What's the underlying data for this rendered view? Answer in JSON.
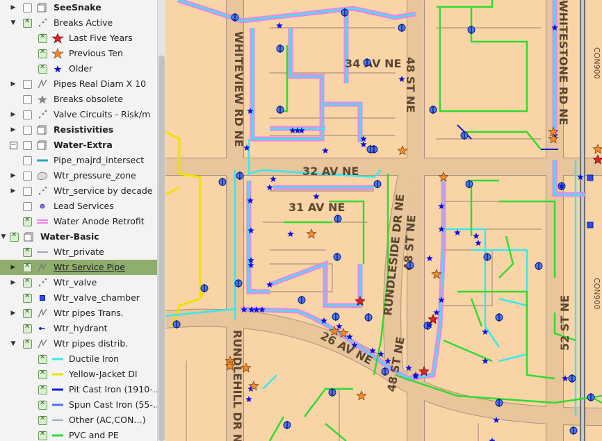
{
  "layers": [
    {
      "label": "SeeSnake",
      "level": 0,
      "expand": "right",
      "check": "off",
      "symbol": "group-icon",
      "bold": true
    },
    {
      "label": "Breaks Active",
      "level": 0,
      "expand": "down",
      "check": "on",
      "symbol": "points-icon"
    },
    {
      "label": "Last Five Years",
      "level": 1,
      "check": "on",
      "symbol": "star-red"
    },
    {
      "label": "Previous Ten",
      "level": 1,
      "check": "on",
      "symbol": "star-orange"
    },
    {
      "label": "Older",
      "level": 1,
      "check": "on",
      "symbol": "star-blue"
    },
    {
      "label": "Pipes Real Diam X 10",
      "level": 0,
      "expand": "right",
      "check": "off",
      "symbol": "line-icon"
    },
    {
      "label": "Breaks obsolete",
      "level": 0,
      "check": "off",
      "symbol": "star-gray"
    },
    {
      "label": "Valve Circuits - Risk/m",
      "level": 0,
      "expand": "right",
      "check": "off",
      "symbol": "points-icon"
    },
    {
      "label": "Resistivities",
      "level": 0,
      "expand": "right",
      "check": "off",
      "symbol": "group-icon",
      "bold": true
    },
    {
      "label": "Water-Extra",
      "level": 0,
      "expand": "minus",
      "check": "off",
      "symbol": "group-icon",
      "bold": true
    },
    {
      "label": "Pipe_majrd_intersect",
      "level": 0,
      "check": "off",
      "symbol": "line-teal"
    },
    {
      "label": "Wtr_pressure_zone",
      "level": 0,
      "expand": "right",
      "check": "off",
      "symbol": "polygon-icon"
    },
    {
      "label": "Wtr_service by decade",
      "level": 0,
      "expand": "right",
      "check": "off",
      "symbol": "points-icon"
    },
    {
      "label": "Lead Services",
      "level": 0,
      "check": "off",
      "symbol": "dot-purple"
    },
    {
      "label": "Water Anode Retrofit",
      "level": 0,
      "check": "on",
      "symbol": "line-pink"
    },
    {
      "label": "Water-Basic",
      "level": 0,
      "expand": "down",
      "check": "on",
      "symbol": "group-icon",
      "bold": true,
      "outdent": true
    },
    {
      "label": "Wtr_private",
      "level": 0,
      "check": "on",
      "symbol": "line-gray"
    },
    {
      "label": "Wtr Service Pipe",
      "level": 0,
      "expand": "right",
      "check": "on",
      "symbol": "line-icon",
      "selected": true
    },
    {
      "label": "Wtr_valve",
      "level": 0,
      "expand": "right",
      "check": "on",
      "symbol": "points-icon"
    },
    {
      "label": "Wtr_valve_chamber",
      "level": 0,
      "check": "on",
      "symbol": "square-blue"
    },
    {
      "label": "Wtr pipes Trans.",
      "level": 0,
      "expand": "right",
      "check": "on",
      "symbol": "line-icon"
    },
    {
      "label": "Wtr_hydrant",
      "level": 0,
      "check": "on",
      "symbol": "hydrant-icon"
    },
    {
      "label": "Wtr pipes distrib.",
      "level": 0,
      "expand": "down",
      "check": "on",
      "symbol": "line-icon"
    },
    {
      "label": "Ductile Iron",
      "level": 1,
      "check": "on",
      "symbol": "line-cyan"
    },
    {
      "label": "Yellow-Jacket DI",
      "level": 1,
      "check": "on",
      "symbol": "line-yellow"
    },
    {
      "label": "Pit Cast Iron (1910-…",
      "level": 1,
      "check": "on",
      "symbol": "line-navy"
    },
    {
      "label": "Spun Cast Iron (55-…",
      "level": 1,
      "check": "on",
      "symbol": "line-blue"
    },
    {
      "label": "Other (AC,CON…)",
      "level": 1,
      "check": "on",
      "symbol": "line-gray"
    },
    {
      "label": "PVC and PE",
      "level": 1,
      "check": "on",
      "symbol": "line-green"
    }
  ],
  "colors": {
    "land": "#f9d4a6",
    "road": "#e8c59a",
    "roadEdge": "#a8927e",
    "cyan": "#38e8f0",
    "green": "#2fdc2f",
    "pink": "#f07cf0",
    "yellow": "#f0e000",
    "navy": "#0a1ad8",
    "orange": "#f58a2a",
    "red": "#e0202a",
    "blue": "#1010e0"
  },
  "streets": [
    {
      "id": "34av",
      "text": "34 AV NE"
    },
    {
      "id": "48st-top",
      "text": "48 ST NE"
    },
    {
      "id": "32av",
      "text": "32 AV NE"
    },
    {
      "id": "31av",
      "text": "31 AV NE"
    },
    {
      "id": "whiteview",
      "text": "WHITEVIEW RD NE"
    },
    {
      "id": "whitestone",
      "text": "WHITESTONE RD NE"
    },
    {
      "id": "rundleside",
      "text": "RUNDLESIDE DR NE"
    },
    {
      "id": "48st-mid",
      "text": "48 ST NE"
    },
    {
      "id": "26av",
      "text": "26 AV NE"
    },
    {
      "id": "48st-bot",
      "text": "48 ST NE"
    },
    {
      "id": "52st",
      "text": "52 ST NE"
    },
    {
      "id": "rundlehill",
      "text": "RUNDLEHILL DR N"
    },
    {
      "id": "con900a",
      "text": "CON900"
    },
    {
      "id": "con900b",
      "text": "CON900"
    }
  ]
}
